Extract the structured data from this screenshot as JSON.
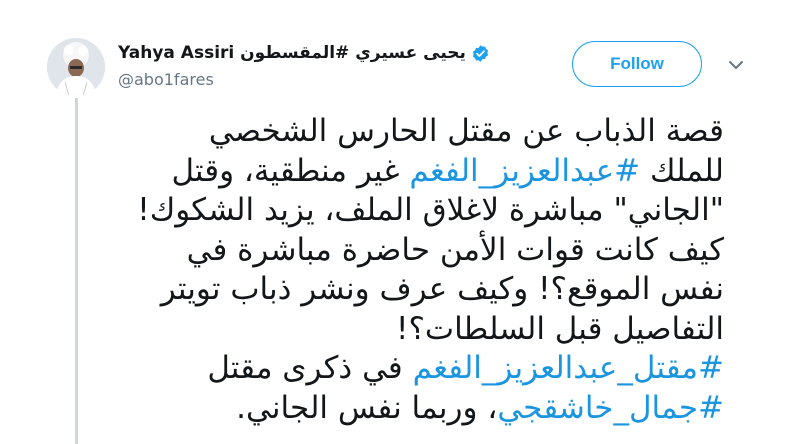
{
  "author": {
    "name": "Yahya Assiri يحيى عسيري #المقسطون",
    "handle": "@abo1fares",
    "verified": true
  },
  "follow_button": {
    "label": "Follow"
  },
  "icons": {
    "avatar": "profile-photo",
    "verified": "verified-badge-icon",
    "caret": "chevron-down-icon"
  },
  "tweet": {
    "lines": [
      [
        {
          "text": "قصة الذباب عن مقتل الحارس الشخصي"
        }
      ],
      [
        {
          "text": "للملك "
        },
        {
          "text": "#عبدالعزيز_الفغم",
          "hashtag": true
        },
        {
          "text": " غير منطقية، وقتل"
        }
      ],
      [
        {
          "text": "\"الجاني\" مباشرة لاغلاق الملف، يزيد الشكوك!"
        }
      ],
      [
        {
          "text": "كيف كانت قوات الأمن حاضرة مباشرة في"
        }
      ],
      [
        {
          "text": "نفس الموقع؟! وكيف عرف ونشر ذباب تويتر"
        }
      ],
      [
        {
          "text": "التفاصيل قبل السلطات؟!"
        }
      ],
      [
        {
          "text": "#مقتل_عبدالعزيز_الفغم",
          "hashtag": true
        },
        {
          "text": " في ذكرى مقتل"
        }
      ],
      [
        {
          "text": "#جمال_خاشقجي",
          "hashtag": true
        },
        {
          "text": "، وربما نفس الجاني."
        }
      ]
    ]
  },
  "colors": {
    "link": "#1b95e0",
    "follow": "#1da1f2",
    "handle": "#657786",
    "thread_line": "#ccd6dd"
  }
}
